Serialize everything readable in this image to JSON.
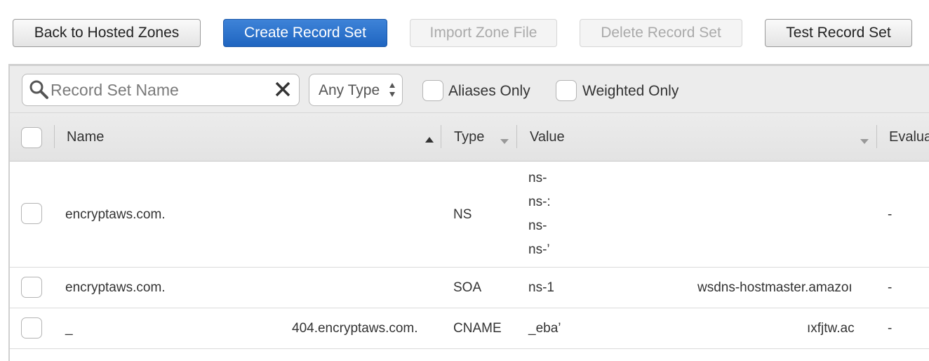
{
  "toolbar_buttons": {
    "back": "Back to Hosted Zones",
    "create": "Create Record Set",
    "import": "Import Zone File",
    "delete": "Delete Record Set",
    "test": "Test Record Set"
  },
  "filters": {
    "search_placeholder": "Record Set Name",
    "type_select": "Any Type",
    "aliases_only": "Aliases Only",
    "weighted_only": "Weighted Only"
  },
  "columns": {
    "name": "Name",
    "type": "Type",
    "value": "Value",
    "evaluate": "Evalua"
  },
  "rows": [
    {
      "name": "encryptaws.com.",
      "type": "NS",
      "value_lines": [
        "ns-",
        "ns-:",
        "ns-",
        "ns-’"
      ],
      "value_right": "",
      "evaluate": "-"
    },
    {
      "name": "encryptaws.com.",
      "type": "SOA",
      "value_lines": [
        "ns-1"
      ],
      "value_right": "wsdns-hostmaster.amazoı",
      "evaluate": "-"
    },
    {
      "name": "_",
      "name_right": "404.encryptaws.com.",
      "type": "CNAME",
      "value_lines": [
        "_eba’"
      ],
      "value_right": "ıxfjtw.aс",
      "evaluate": "-"
    }
  ],
  "colors": {
    "primary": "#2a73cf",
    "border": "#d0d0d0",
    "toolbar_bg": "#ececec"
  }
}
